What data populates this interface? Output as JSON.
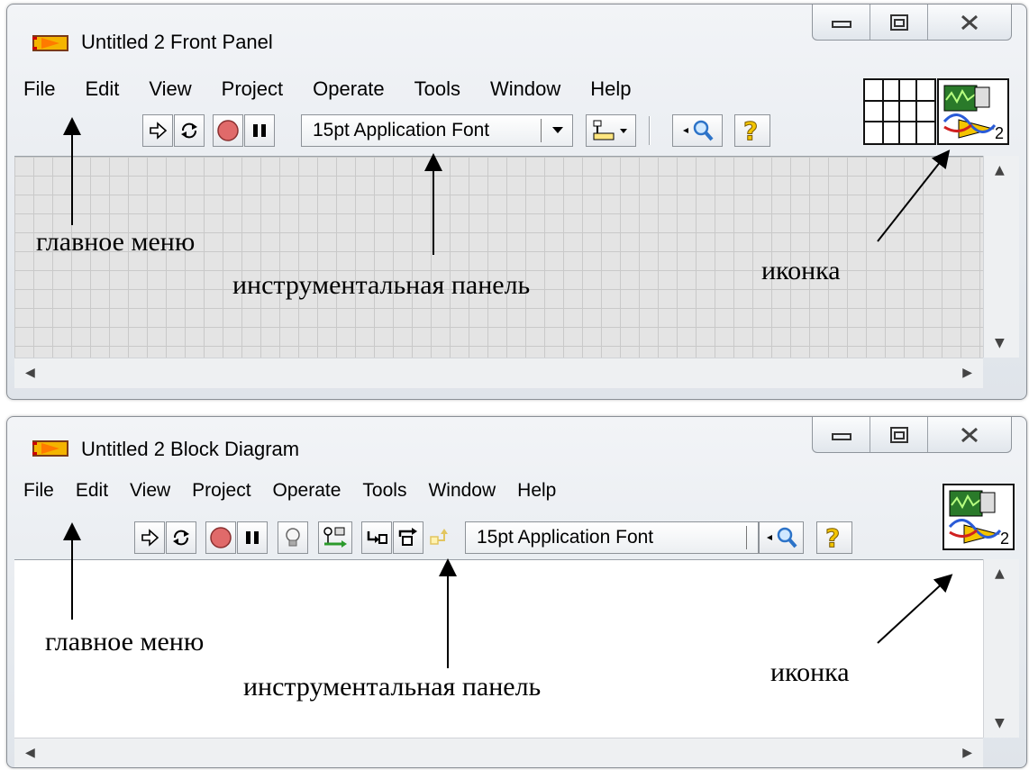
{
  "front_panel": {
    "title": "Untitled 2 Front Panel",
    "menu": [
      "File",
      "Edit",
      "View",
      "Project",
      "Operate",
      "Tools",
      "Window",
      "Help"
    ],
    "font_selector": "15pt Application Font",
    "icon_label": "2"
  },
  "block_diagram": {
    "title": "Untitled 2 Block Diagram",
    "menu": [
      "File",
      "Edit",
      "View",
      "Project",
      "Operate",
      "Tools",
      "Window",
      "Help"
    ],
    "font_selector": "15pt Application Font",
    "icon_label": "2"
  },
  "annotations": {
    "main_menu": "главное меню",
    "toolbar": "инструментальная панель",
    "icon": "иконка"
  },
  "colors": {
    "stop_button": "#e06a6a",
    "help_icon": "#f2c400",
    "icon_border": "#111111",
    "grid_line": "#c9c9c9"
  }
}
